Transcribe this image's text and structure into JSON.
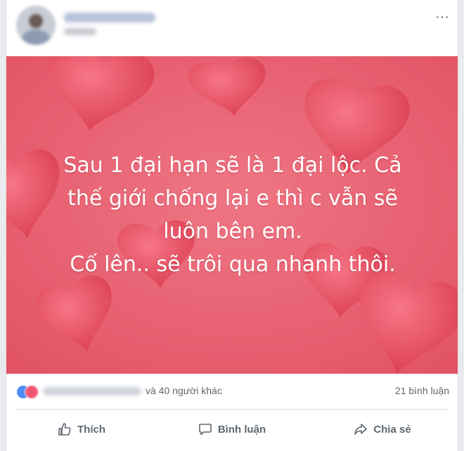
{
  "post": {
    "status_text_lines": [
      "Sau 1 đại hạn sẽ là 1 đại lộc. Cả",
      "thế giới chống lại e thì c vẫn sẽ",
      "luôn bên em.",
      "Cố lên.. sẽ trôi qua nhanh thôi."
    ],
    "background_color": "#e86273",
    "heart_color": "#ea4c5e"
  },
  "header": {
    "more_icon": "more-horizontal-icon",
    "more_glyph": "···"
  },
  "reactions": {
    "others_text": "và 40 người khác",
    "comments_text": "21 bình luận"
  },
  "actions": [
    {
      "label": "Thích",
      "icon": "thumbs-up-icon"
    },
    {
      "label": "Bình luận",
      "icon": "comment-icon"
    },
    {
      "label": "Chia sẻ",
      "icon": "share-icon"
    }
  ]
}
